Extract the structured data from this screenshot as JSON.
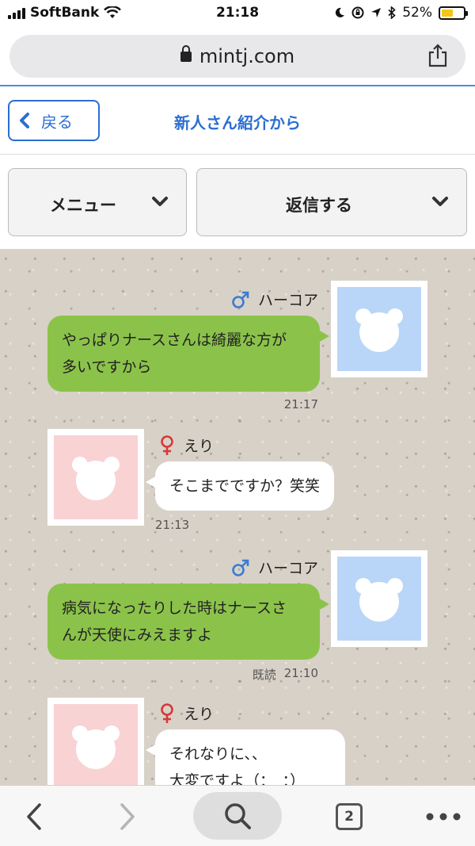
{
  "status_bar": {
    "carrier": "SoftBank",
    "time": "21:18",
    "battery": "52%",
    "battery_level": 0.52
  },
  "browser": {
    "url": "mintj.com"
  },
  "header": {
    "back_label": "戻る",
    "title": "新人さん紹介から"
  },
  "actions": {
    "menu_label": "メニュー",
    "reply_label": "返信する"
  },
  "messages": [
    {
      "sender": "ハーコア",
      "gender": "male",
      "side": "right",
      "text_lines": [
        "やっぱりナースさんは綺麗な方が",
        "多いですから"
      ],
      "time": "21:17",
      "read": ""
    },
    {
      "sender": "えり",
      "gender": "female",
      "side": "left",
      "text_lines": [
        "そこまでですか？笑笑"
      ],
      "time": "21:13",
      "read": ""
    },
    {
      "sender": "ハーコア",
      "gender": "male",
      "side": "right",
      "text_lines": [
        "病気になったりした時はナースさ",
        "んが天使にみえますよ"
      ],
      "time": "21:10",
      "read": "既読"
    },
    {
      "sender": "えり",
      "gender": "female",
      "side": "left",
      "text_lines": [
        "それなりに、、",
        "大変ですよ（：　：）"
      ],
      "time": "",
      "read": ""
    }
  ],
  "toolbar": {
    "tab_count": "2"
  },
  "icons": [
    "signal-icon",
    "wifi-icon",
    "moon-icon",
    "rotation-lock-icon",
    "location-icon",
    "bluetooth-icon",
    "battery-icon",
    "lock-icon",
    "share-icon",
    "back-chevron-icon",
    "chevron-down-icon",
    "male-icon",
    "female-icon",
    "bear-avatar-icon",
    "back-arrow-icon",
    "forward-arrow-icon",
    "search-icon",
    "tabs-icon",
    "more-icon"
  ],
  "colors": {
    "accent_blue": "#2b6ed1",
    "bubble_green": "#8bc34a",
    "male_blue": "#3a7bd5",
    "female_red": "#d9383a"
  }
}
